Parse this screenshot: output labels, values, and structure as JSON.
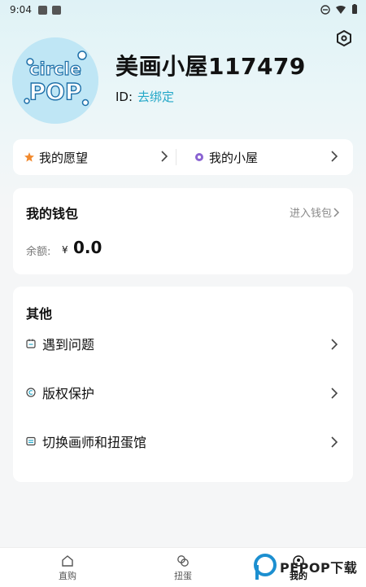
{
  "status_bar": {
    "time": "9:04"
  },
  "profile": {
    "nickname": "美画小屋117479",
    "id_label": "ID:",
    "bind_link": "去绑定",
    "avatar_text_top": "circle",
    "avatar_text_bottom": "POP"
  },
  "quick_links": [
    {
      "label": "我的愿望",
      "icon": "wish-star-icon",
      "color": "#f28a2e"
    },
    {
      "label": "我的小屋",
      "icon": "house-flower-icon",
      "color": "#8a63d2"
    }
  ],
  "wallet": {
    "title": "我的钱包",
    "enter_label": "进入钱包",
    "balance_label": "余额:",
    "currency": "¥",
    "amount": "0.0"
  },
  "other": {
    "title": "其他",
    "items": [
      {
        "label": "遇到问题",
        "icon": "calendar-question-icon"
      },
      {
        "label": "版权保护",
        "icon": "copyright-icon"
      },
      {
        "label": "切换画师和扭蛋馆",
        "icon": "switch-icon"
      }
    ]
  },
  "tabbar": {
    "tabs": [
      {
        "label": "直购",
        "icon": "home-icon"
      },
      {
        "label": "扭蛋",
        "icon": "capsule-icon"
      },
      {
        "label": "我的",
        "icon": "profile-icon"
      }
    ]
  },
  "watermark": {
    "text": "PEPOP下载"
  },
  "colors": {
    "accent": "#25a8c8",
    "background": "#f5f6f7"
  }
}
